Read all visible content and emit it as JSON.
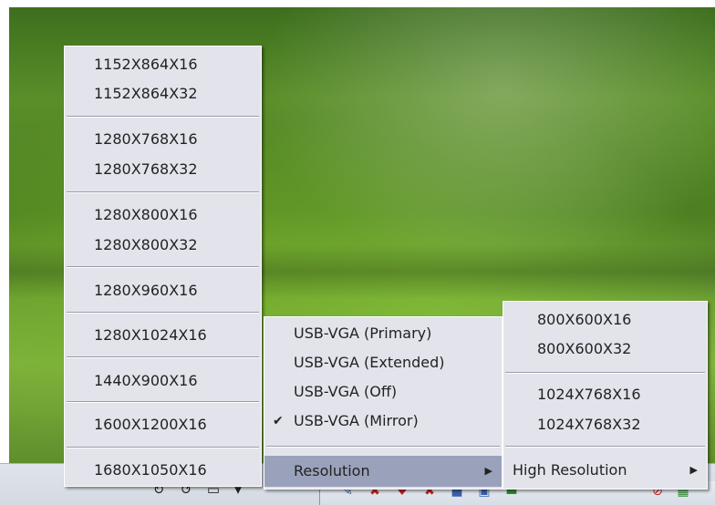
{
  "resolution_menu": {
    "items": [
      "1152X864X16",
      "1152X864X32",
      "1280X768X16",
      "1280X768X32",
      "1280X800X16",
      "1280X800X32",
      "1280X960X16",
      "1280X1024X16",
      "1440X900X16",
      "1600X1200X16",
      "1680X1050X16"
    ]
  },
  "main_menu": {
    "primary": "USB-VGA (Primary)",
    "extended": "USB-VGA (Extended)",
    "off": "USB-VGA (Off)",
    "mirror": "USB-VGA (Mirror)",
    "resolution": "Resolution",
    "check_mark": "✔",
    "submenu_arrow": "▶"
  },
  "standard_menu": {
    "items": [
      "800X600X16",
      "800X600X32",
      "1024X768X16",
      "1024X768X32"
    ],
    "high_resolution": "High Resolution"
  },
  "icons": {
    "check": "check-icon",
    "submenu": "submenu-arrow-icon"
  }
}
